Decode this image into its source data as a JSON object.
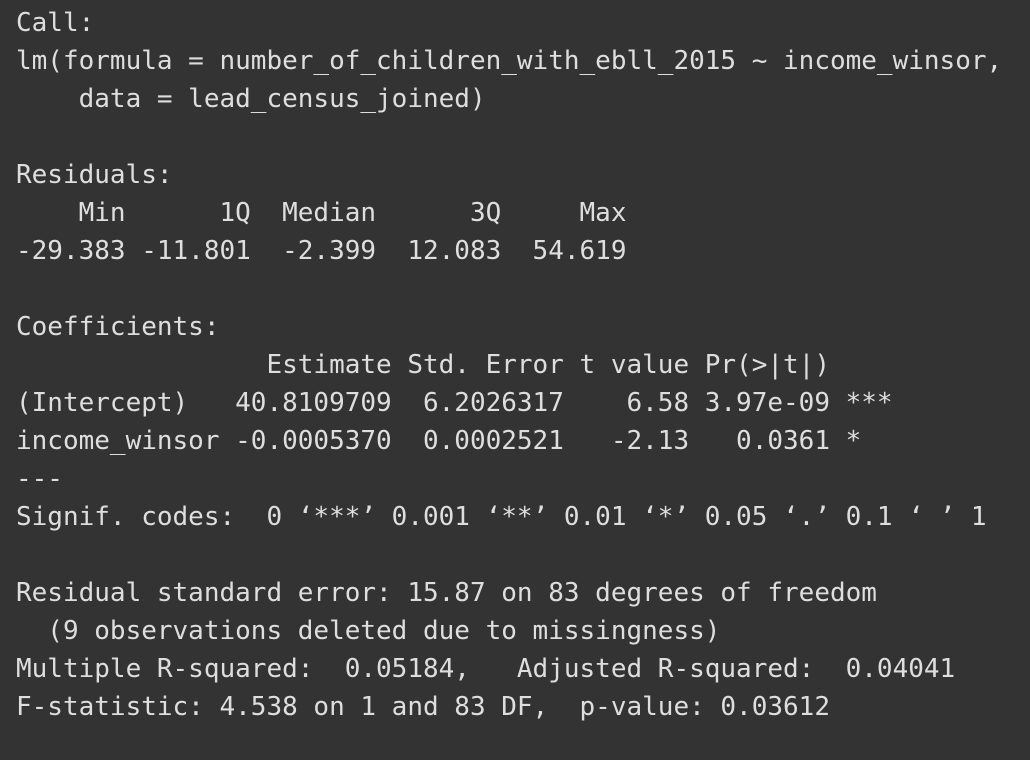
{
  "output": {
    "lines": [
      "Call:",
      "lm(formula = number_of_children_with_ebll_2015 ~ income_winsor,",
      "    data = lead_census_joined)",
      "",
      "Residuals:",
      "    Min      1Q  Median      3Q     Max ",
      "-29.383 -11.801  -2.399  12.083  54.619 ",
      "",
      "Coefficients:",
      "                Estimate Std. Error t value Pr(>|t|)    ",
      "(Intercept)   40.8109709  6.2026317    6.58 3.97e-09 ***",
      "income_winsor -0.0005370  0.0002521   -2.13   0.0361 *  ",
      "---",
      "Signif. codes:  0 ‘***’ 0.001 ‘**’ 0.01 ‘*’ 0.05 ‘.’ 0.1 ‘ ’ 1",
      "",
      "Residual standard error: 15.87 on 83 degrees of freedom",
      "  (9 observations deleted due to missingness)",
      "Multiple R-squared:  0.05184,\tAdjusted R-squared:  0.04041 ",
      "F-statistic: 4.538 on 1 and 83 DF,  p-value: 0.03612"
    ]
  }
}
